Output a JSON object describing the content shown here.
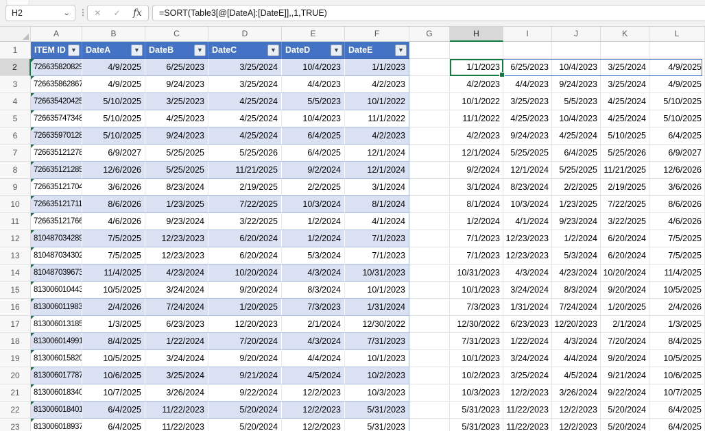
{
  "name_box": {
    "value": "H2"
  },
  "formula_bar": {
    "formula": "=SORT(Table3[@[DateA]:[DateE]],,1,TRUE)",
    "cancel_glyph": "✕",
    "enter_glyph": "✓",
    "fx_glyph": "fx",
    "menu_glyph": "⋮",
    "namebox_chevron": "⌄"
  },
  "grid": {
    "column_letters": [
      "A",
      "B",
      "C",
      "D",
      "E",
      "F",
      "G",
      "H",
      "I",
      "J",
      "K",
      "L"
    ],
    "active_column": "H",
    "active_cell": "H2",
    "row_numbers": [
      "1",
      "2",
      "3",
      "4",
      "5",
      "6",
      "7",
      "8",
      "9",
      "10",
      "11",
      "12",
      "13",
      "14",
      "15",
      "16",
      "17",
      "18",
      "19",
      "20",
      "21",
      "22",
      "23"
    ]
  },
  "colors": {
    "table_header_fill": "#4472C4",
    "band_fill": "#D9E1F2",
    "active_cell_border": "#107C41",
    "spill_border": "#4472C4",
    "error_triangle": "#1E7145"
  },
  "table": {
    "filter_glyph": "▼",
    "headers": [
      "ITEM ID",
      "DateA",
      "DateB",
      "DateC",
      "DateD",
      "DateE"
    ],
    "rows": [
      {
        "id": "726635820829",
        "dates": [
          "4/9/2025",
          "6/25/2023",
          "3/25/2024",
          "10/4/2023",
          "1/1/2023"
        ]
      },
      {
        "id": "726635862867",
        "dates": [
          "4/9/2025",
          "9/24/2023",
          "3/25/2024",
          "4/4/2023",
          "4/2/2023"
        ]
      },
      {
        "id": "726635420425",
        "dates": [
          "5/10/2025",
          "3/25/2023",
          "4/25/2024",
          "5/5/2023",
          "10/1/2022"
        ]
      },
      {
        "id": "726635747348",
        "dates": [
          "5/10/2025",
          "4/25/2023",
          "4/25/2024",
          "10/4/2023",
          "11/1/2022"
        ]
      },
      {
        "id": "726635970128",
        "dates": [
          "5/10/2025",
          "9/24/2023",
          "4/25/2024",
          "6/4/2025",
          "4/2/2023"
        ]
      },
      {
        "id": "726635121278",
        "dates": [
          "6/9/2027",
          "5/25/2025",
          "5/25/2026",
          "6/4/2025",
          "12/1/2024"
        ]
      },
      {
        "id": "726635121285",
        "dates": [
          "12/6/2026",
          "5/25/2025",
          "11/21/2025",
          "9/2/2024",
          "12/1/2024"
        ]
      },
      {
        "id": "726635121704",
        "dates": [
          "3/6/2026",
          "8/23/2024",
          "2/19/2025",
          "2/2/2025",
          "3/1/2024"
        ]
      },
      {
        "id": "726635121711",
        "dates": [
          "8/6/2026",
          "1/23/2025",
          "7/22/2025",
          "10/3/2024",
          "8/1/2024"
        ]
      },
      {
        "id": "726635121766",
        "dates": [
          "4/6/2026",
          "9/23/2024",
          "3/22/2025",
          "1/2/2024",
          "4/1/2024"
        ]
      },
      {
        "id": "810487034289",
        "dates": [
          "7/5/2025",
          "12/23/2023",
          "6/20/2024",
          "1/2/2024",
          "7/1/2023"
        ]
      },
      {
        "id": "810487034302",
        "dates": [
          "7/5/2025",
          "12/23/2023",
          "6/20/2024",
          "5/3/2024",
          "7/1/2023"
        ]
      },
      {
        "id": "810487039673",
        "dates": [
          "11/4/2025",
          "4/23/2024",
          "10/20/2024",
          "4/3/2024",
          "10/31/2023"
        ]
      },
      {
        "id": "813006010443",
        "dates": [
          "10/5/2025",
          "3/24/2024",
          "9/20/2024",
          "8/3/2024",
          "10/1/2023"
        ]
      },
      {
        "id": "813006011983",
        "dates": [
          "2/4/2026",
          "7/24/2024",
          "1/20/2025",
          "7/3/2023",
          "1/31/2024"
        ]
      },
      {
        "id": "813006013185",
        "dates": [
          "1/3/2025",
          "6/23/2023",
          "12/20/2023",
          "2/1/2024",
          "12/30/2022"
        ]
      },
      {
        "id": "813006014991",
        "dates": [
          "8/4/2025",
          "1/22/2024",
          "7/20/2024",
          "4/3/2024",
          "7/31/2023"
        ]
      },
      {
        "id": "813006015820",
        "dates": [
          "10/5/2025",
          "3/24/2024",
          "9/20/2024",
          "4/4/2024",
          "10/1/2023"
        ]
      },
      {
        "id": "813006017787",
        "dates": [
          "10/6/2025",
          "3/25/2024",
          "9/21/2024",
          "4/5/2024",
          "10/2/2023"
        ]
      },
      {
        "id": "813006018340",
        "dates": [
          "10/7/2025",
          "3/26/2024",
          "9/22/2024",
          "12/2/2023",
          "10/3/2023"
        ]
      },
      {
        "id": "813006018401",
        "dates": [
          "6/4/2025",
          "11/22/2023",
          "5/20/2024",
          "12/2/2023",
          "5/31/2023"
        ]
      },
      {
        "id": "813006018937",
        "dates": [
          "6/4/2025",
          "11/22/2023",
          "5/20/2024",
          "12/2/2023",
          "5/31/2023"
        ]
      }
    ]
  },
  "spill": {
    "rows": [
      [
        "1/1/2023",
        "6/25/2023",
        "10/4/2023",
        "3/25/2024",
        "4/9/2025"
      ],
      [
        "4/2/2023",
        "4/4/2023",
        "9/24/2023",
        "3/25/2024",
        "4/9/2025"
      ],
      [
        "10/1/2022",
        "3/25/2023",
        "5/5/2023",
        "4/25/2024",
        "5/10/2025"
      ],
      [
        "11/1/2022",
        "4/25/2023",
        "10/4/2023",
        "4/25/2024",
        "5/10/2025"
      ],
      [
        "4/2/2023",
        "9/24/2023",
        "4/25/2024",
        "5/10/2025",
        "6/4/2025"
      ],
      [
        "12/1/2024",
        "5/25/2025",
        "6/4/2025",
        "5/25/2026",
        "6/9/2027"
      ],
      [
        "9/2/2024",
        "12/1/2024",
        "5/25/2025",
        "11/21/2025",
        "12/6/2026"
      ],
      [
        "3/1/2024",
        "8/23/2024",
        "2/2/2025",
        "2/19/2025",
        "3/6/2026"
      ],
      [
        "8/1/2024",
        "10/3/2024",
        "1/23/2025",
        "7/22/2025",
        "8/6/2026"
      ],
      [
        "1/2/2024",
        "4/1/2024",
        "9/23/2024",
        "3/22/2025",
        "4/6/2026"
      ],
      [
        "7/1/2023",
        "12/23/2023",
        "1/2/2024",
        "6/20/2024",
        "7/5/2025"
      ],
      [
        "7/1/2023",
        "12/23/2023",
        "5/3/2024",
        "6/20/2024",
        "7/5/2025"
      ],
      [
        "10/31/2023",
        "4/3/2024",
        "4/23/2024",
        "10/20/2024",
        "11/4/2025"
      ],
      [
        "10/1/2023",
        "3/24/2024",
        "8/3/2024",
        "9/20/2024",
        "10/5/2025"
      ],
      [
        "7/3/2023",
        "1/31/2024",
        "7/24/2024",
        "1/20/2025",
        "2/4/2026"
      ],
      [
        "12/30/2022",
        "6/23/2023",
        "12/20/2023",
        "2/1/2024",
        "1/3/2025"
      ],
      [
        "7/31/2023",
        "1/22/2024",
        "4/3/2024",
        "7/20/2024",
        "8/4/2025"
      ],
      [
        "10/1/2023",
        "3/24/2024",
        "4/4/2024",
        "9/20/2024",
        "10/5/2025"
      ],
      [
        "10/2/2023",
        "3/25/2024",
        "4/5/2024",
        "9/21/2024",
        "10/6/2025"
      ],
      [
        "10/3/2023",
        "12/2/2023",
        "3/26/2024",
        "9/22/2024",
        "10/7/2025"
      ],
      [
        "5/31/2023",
        "11/22/2023",
        "12/2/2023",
        "5/20/2024",
        "6/4/2025"
      ],
      [
        "5/31/2023",
        "11/22/2023",
        "12/2/2023",
        "5/20/2024",
        "6/4/2025"
      ]
    ]
  }
}
